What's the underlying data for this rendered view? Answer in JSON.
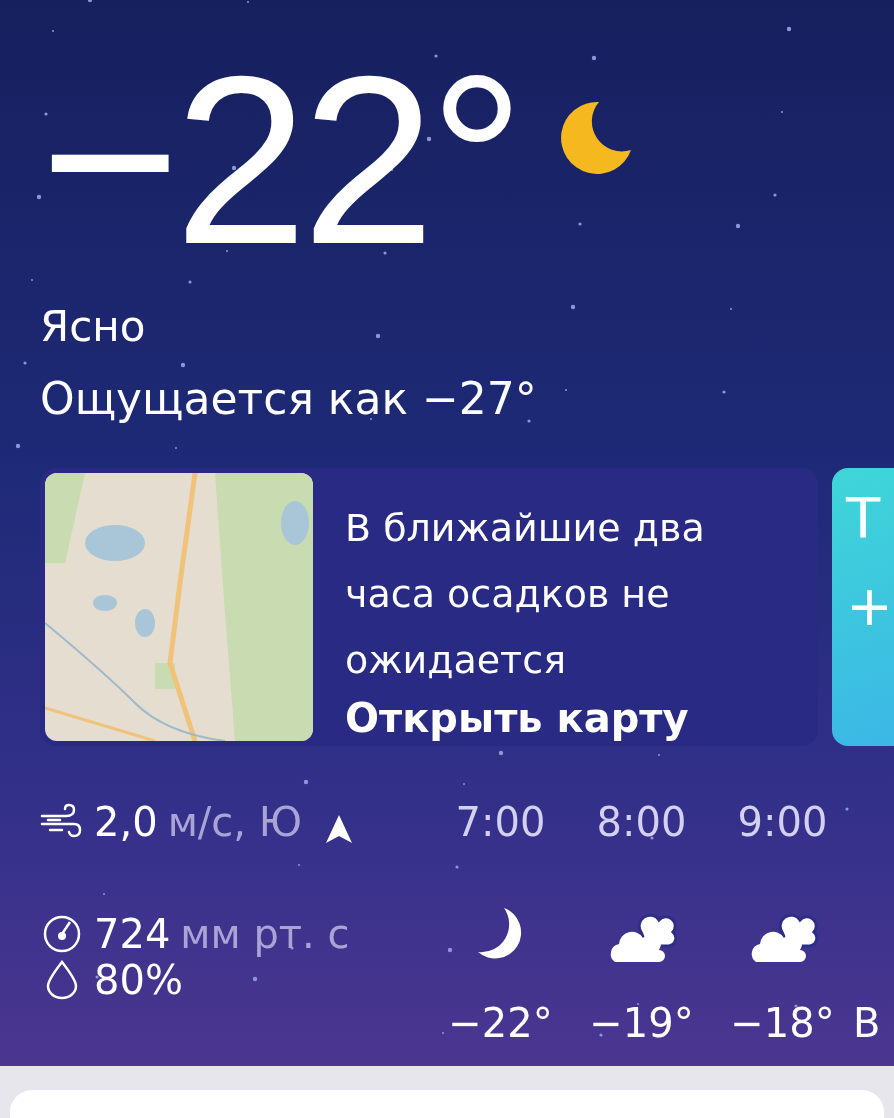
{
  "current": {
    "temperature": "−22°",
    "condition": "Ясно",
    "feels_like": "Ощущается как −27°"
  },
  "cards": [
    {
      "kind": "nowcast",
      "text": "В ближайшие два часа осадков не ожидается",
      "link": "Открыть карту"
    },
    {
      "kind": "partial",
      "title": "Т",
      "symbol": "+"
    }
  ],
  "details": {
    "wind_value": "2,0",
    "wind_unit": "м/с, Ю",
    "pressure_value": "724",
    "pressure_unit": "мм рт. с",
    "humidity": "80%"
  },
  "hourly": [
    {
      "time": "7:00",
      "kind": "moon",
      "temp": "−22°"
    },
    {
      "time": "8:00",
      "kind": "clouds",
      "temp": "−19°"
    },
    {
      "time": "9:00",
      "kind": "clouds",
      "temp": "−18°"
    }
  ],
  "hourly_more": "В"
}
